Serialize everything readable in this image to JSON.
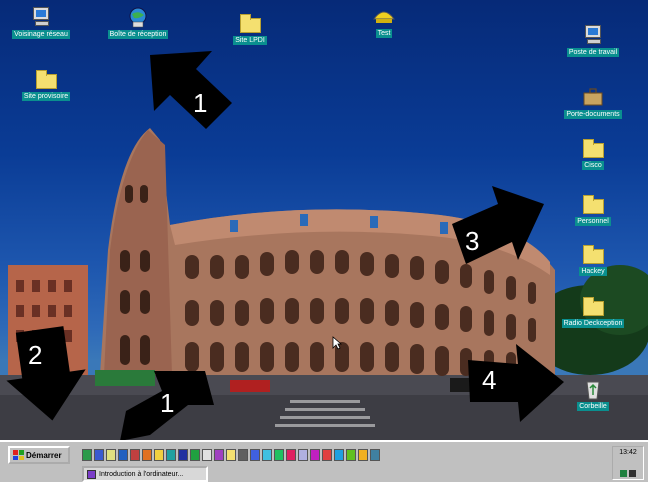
{
  "desktop": {
    "icons": [
      {
        "label": "Voisinage réseau",
        "icon": "network-neighborhood-icon"
      },
      {
        "label": "Boîte de réception",
        "icon": "inbox-globe-icon"
      },
      {
        "label": "Site LPDI",
        "icon": "folder-icon"
      },
      {
        "label": "Test",
        "icon": "test-icon"
      },
      {
        "label": "Site provisoire",
        "icon": "folder-icon"
      },
      {
        "label": "Poste de travail",
        "icon": "my-computer-icon"
      },
      {
        "label": "Porte-documents",
        "icon": "briefcase-icon"
      },
      {
        "label": "Cisco",
        "icon": "folder-icon"
      },
      {
        "label": "Personnel",
        "icon": "folder-icon"
      },
      {
        "label": "Hackey",
        "icon": "folder-icon"
      },
      {
        "label": "Radio Deckception",
        "icon": "folder-icon"
      },
      {
        "label": "Corbeille",
        "icon": "recycle-bin-icon"
      }
    ]
  },
  "annotations": {
    "one_top": "1",
    "two": "2",
    "one_bottom": "1",
    "three": "3",
    "four": "4"
  },
  "taskbar": {
    "start_label": "Démarrer",
    "task_label": "Introduction à l'ordinateur...",
    "clock": "13:42"
  },
  "colors": {
    "icon_label_bg": "#0a8f8f",
    "taskbar": "#c0c0c0",
    "folder": "#f4e070",
    "arrow": "#000000"
  }
}
